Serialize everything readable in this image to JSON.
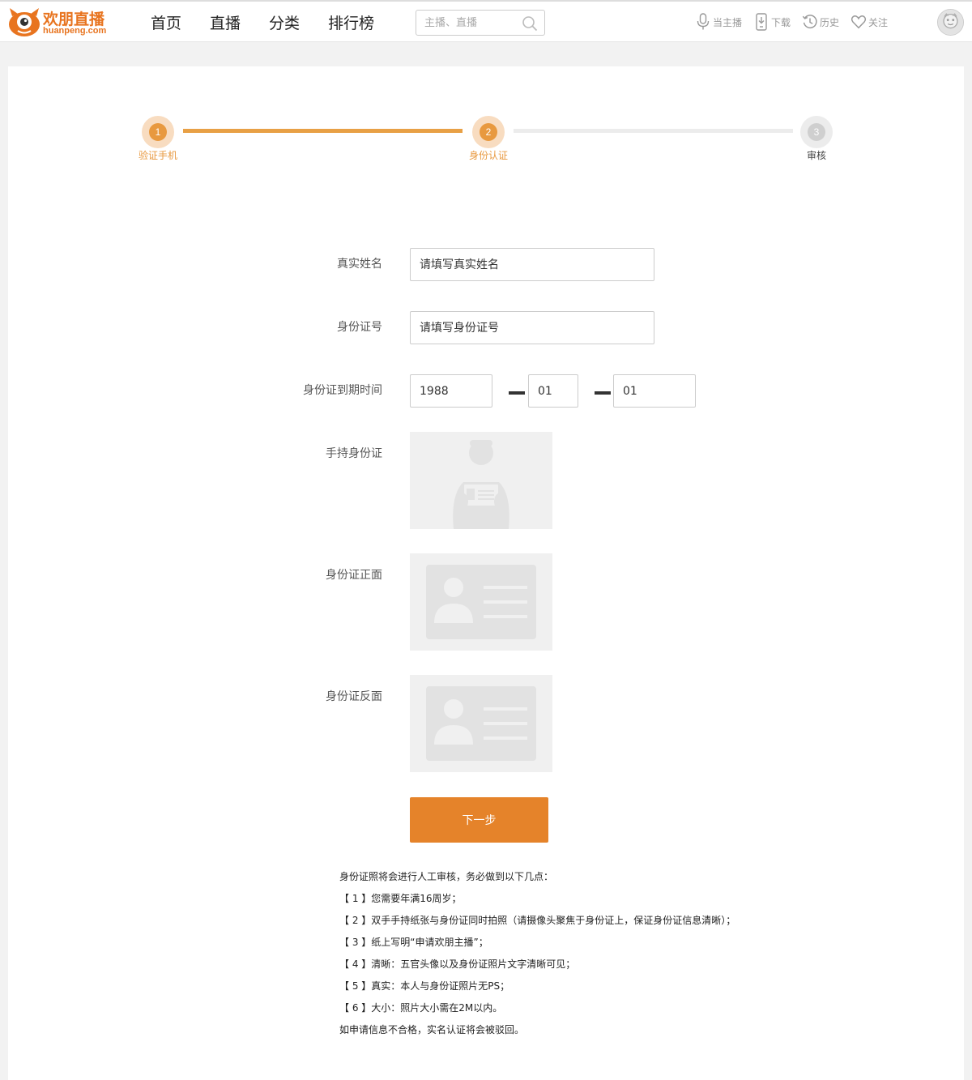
{
  "header": {
    "logo_cn": "欢朋直播",
    "logo_en": "huanpeng.com",
    "nav": [
      "首页",
      "直播",
      "分类",
      "排行榜"
    ],
    "search_placeholder": "主播、直播",
    "links": {
      "anchor": "当主播",
      "download": "下载",
      "history": "历史",
      "follow": "关注"
    }
  },
  "steps": [
    {
      "number": "1",
      "label": "验证手机",
      "state": "active"
    },
    {
      "number": "2",
      "label": "身份认证",
      "state": "active"
    },
    {
      "number": "3",
      "label": "审核",
      "state": "pending"
    }
  ],
  "form": {
    "name_label": "真实姓名",
    "name_placeholder": "请填写真实姓名",
    "id_label": "身份证号",
    "id_placeholder": "请填写身份证号",
    "expire_label": "身份证到期时间",
    "expire_year": "1988",
    "expire_month": "01",
    "expire_day": "01",
    "hold_label": "手持身份证",
    "front_label": "身份证正面",
    "back_label": "身份证反面",
    "next_button": "下一步"
  },
  "notes": {
    "intro": "身份证照将会进行人工审核，务必做到以下几点：",
    "items": [
      "【 1 】您需要年满16周岁；",
      "【 2 】双手手持纸张与身份证同时拍照（请摄像头聚焦于身份证上，保证身份证信息清晰）；",
      "【 3 】纸上写明“申请欢朋主播”；",
      "【 4 】清晰：五官头像以及身份证照片文字清晰可见；",
      "【 5 】真实：本人与身份证照片无PS；",
      "【 6 】大小：照片大小需在2M以内。"
    ],
    "outro": "如申请信息不合格，实名认证将会被驳回。"
  },
  "colors": {
    "brand": "#e8741f",
    "step_active": "#e8993f",
    "button": "#e5832a"
  }
}
